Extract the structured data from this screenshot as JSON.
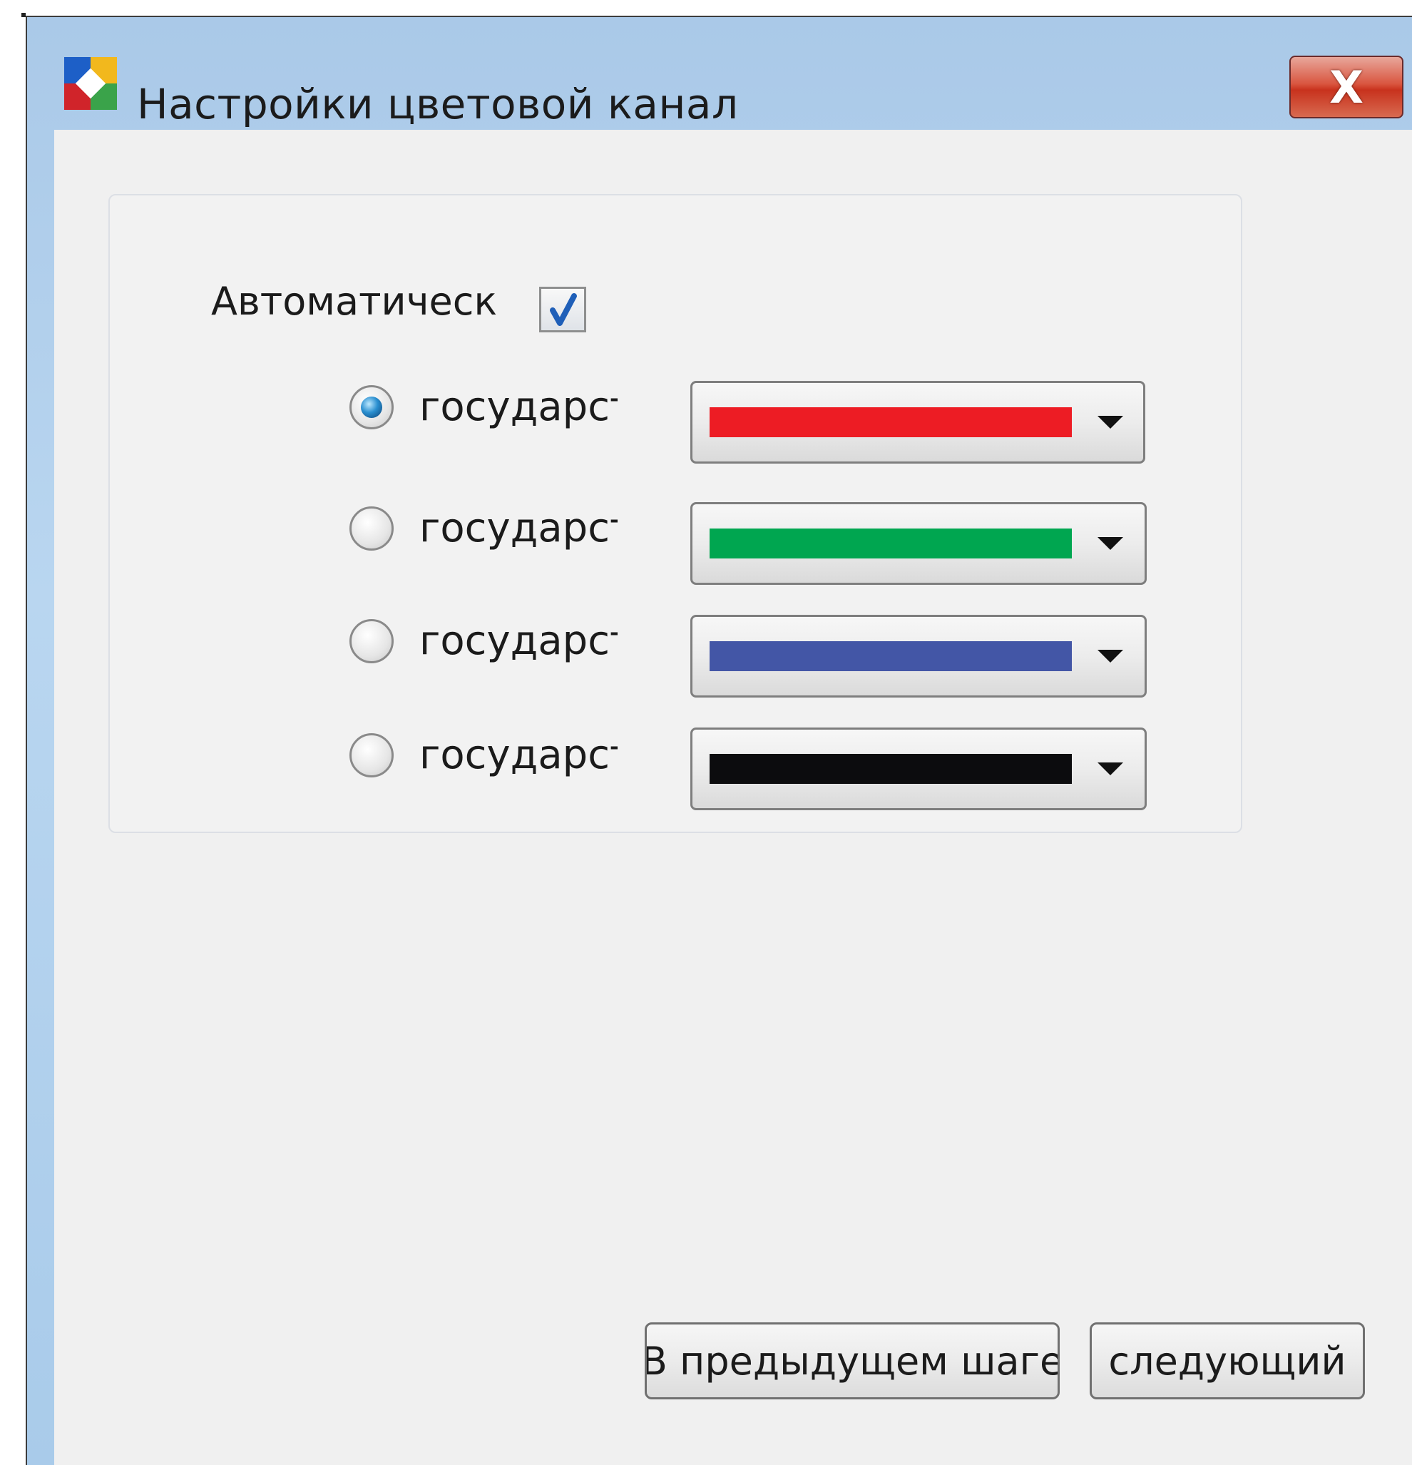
{
  "window": {
    "title": "Настройки цветовой канал",
    "close_label": "X"
  },
  "group": {
    "auto_label": "Автоматическ",
    "auto_checked": true,
    "rows": [
      {
        "label": "государст",
        "selected": true,
        "color": "#ed1c24"
      },
      {
        "label": "государст",
        "selected": false,
        "color": "#00a650"
      },
      {
        "label": "государст",
        "selected": false,
        "color": "#4356a6"
      },
      {
        "label": "государст",
        "selected": false,
        "color": "#0c0c0e"
      }
    ]
  },
  "buttons": {
    "prev_label": "В предыдущем шаге",
    "next_label": "следующий"
  },
  "icons": {
    "app": "app-logo-icon",
    "close": "close-icon",
    "check": "checkmark-icon",
    "dropdown": "chevron-down-icon"
  }
}
